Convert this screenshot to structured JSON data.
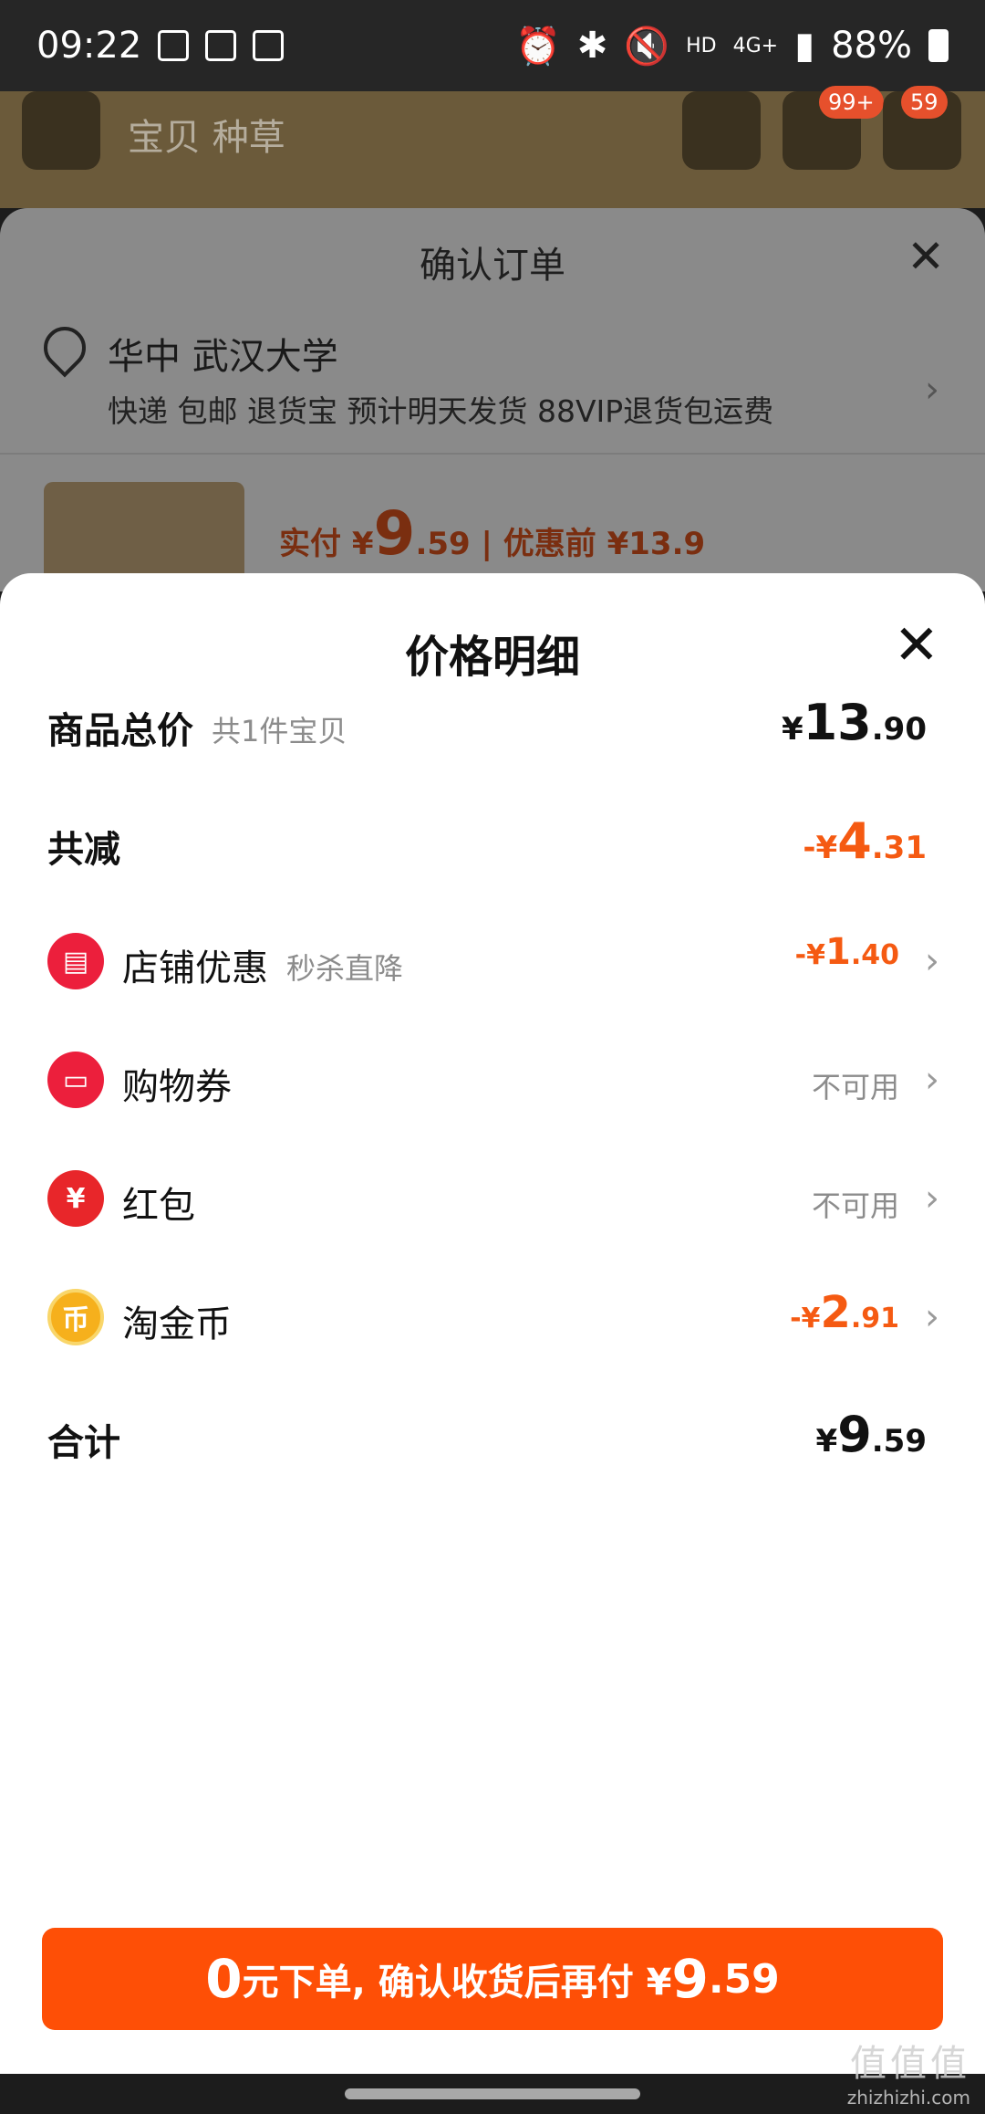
{
  "status_bar": {
    "time": "09:22",
    "network": "4G+",
    "hd": "HD",
    "battery": "88%"
  },
  "background_page": {
    "title": "宝贝 种草",
    "cart_badge": "99+",
    "msg_badge": "59"
  },
  "confirm_order": {
    "title": "确认订单",
    "address": "华中 武汉大学",
    "delivery": "快递 包邮 退货宝 预计明天发货 88VIP退货包运费",
    "price_prefix": "实付 ¥",
    "price_int": "9",
    "price_dec": ".59",
    "price_before": "优惠前 ¥13.9"
  },
  "price_detail": {
    "title": "价格明细",
    "rows": [
      {
        "label": "商品总价",
        "hint": "共1件宝贝",
        "currency": "¥",
        "int": "13",
        "dec": ".90"
      },
      {
        "label": "共减",
        "currency": "-¥",
        "int": "4",
        "dec": ".31"
      },
      {
        "label": "店铺优惠",
        "hint": "秒杀直降",
        "currency": "-¥",
        "int": "1",
        "dec": ".40"
      },
      {
        "label": "购物券",
        "state": "不可用"
      },
      {
        "label": "红包",
        "state": "不可用"
      },
      {
        "label": "淘金币",
        "currency": "-¥",
        "int": "2",
        "dec": ".91"
      },
      {
        "label": "合计",
        "currency": "¥",
        "int": "9",
        "dec": ".59"
      }
    ]
  },
  "cta": {
    "zero": "0",
    "text": "元下单, 确认收货后再付 ¥",
    "int": "9",
    "dec": ".59"
  },
  "watermark": {
    "logo": "值值值",
    "url": "zhizhizhi.com"
  },
  "colors": {
    "accent": "#fe4f06",
    "discount": "#f55a12",
    "store_icon": "#ec1f3c",
    "coin": "#f6b01c"
  }
}
